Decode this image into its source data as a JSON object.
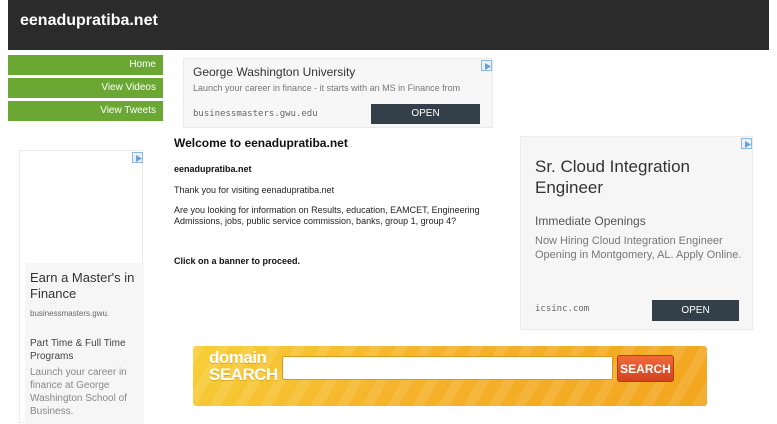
{
  "header": {
    "site_title": "eenadupratiba.net"
  },
  "nav": {
    "items": [
      {
        "label": "Home"
      },
      {
        "label": "View Videos"
      },
      {
        "label": "View Tweets"
      }
    ]
  },
  "ads": {
    "top": {
      "title": "George Washington University",
      "description": "Launch your career in finance - it starts with an MS in Finance from",
      "url": "businessmasters.gwu.edu",
      "button": "OPEN"
    },
    "right": {
      "title": "Sr. Cloud Integration Engineer",
      "headline": "Immediate Openings",
      "body": "Now Hiring Cloud Integration Engineer Opening in Montgomery, AL. Apply Online.",
      "url": "icsinc.com",
      "button": "OPEN"
    },
    "left": {
      "title": "Earn a Master's in Finance",
      "url": "businessmasters.gwu.",
      "headline": "Part Time & Full Time Programs",
      "body": "Launch your career in finance at George Washington School of Business."
    },
    "adchoices_icon": "adchoices-icon"
  },
  "main": {
    "welcome": "Welcome to eenadupratiba.net",
    "domain": "eenadupratiba.net",
    "thanks": "Thank you for visiting eenadupratiba.net",
    "question": "Are you looking for information on Results, education, EAMCET, Engineering Admissions, jobs, public service commission, banks, group 1, group 4?",
    "cta": "Click on a banner to proceed."
  },
  "domain_search": {
    "brand_line1": "domain",
    "brand_line2": "SEARCH",
    "input_value": "",
    "button": "SEARCH"
  },
  "colors": {
    "header_bg": "#2b2b2b",
    "nav_green": "#6aa733",
    "ad_button": "#334049",
    "banner_orange": "#f5b22a",
    "search_button": "#e0522a"
  }
}
